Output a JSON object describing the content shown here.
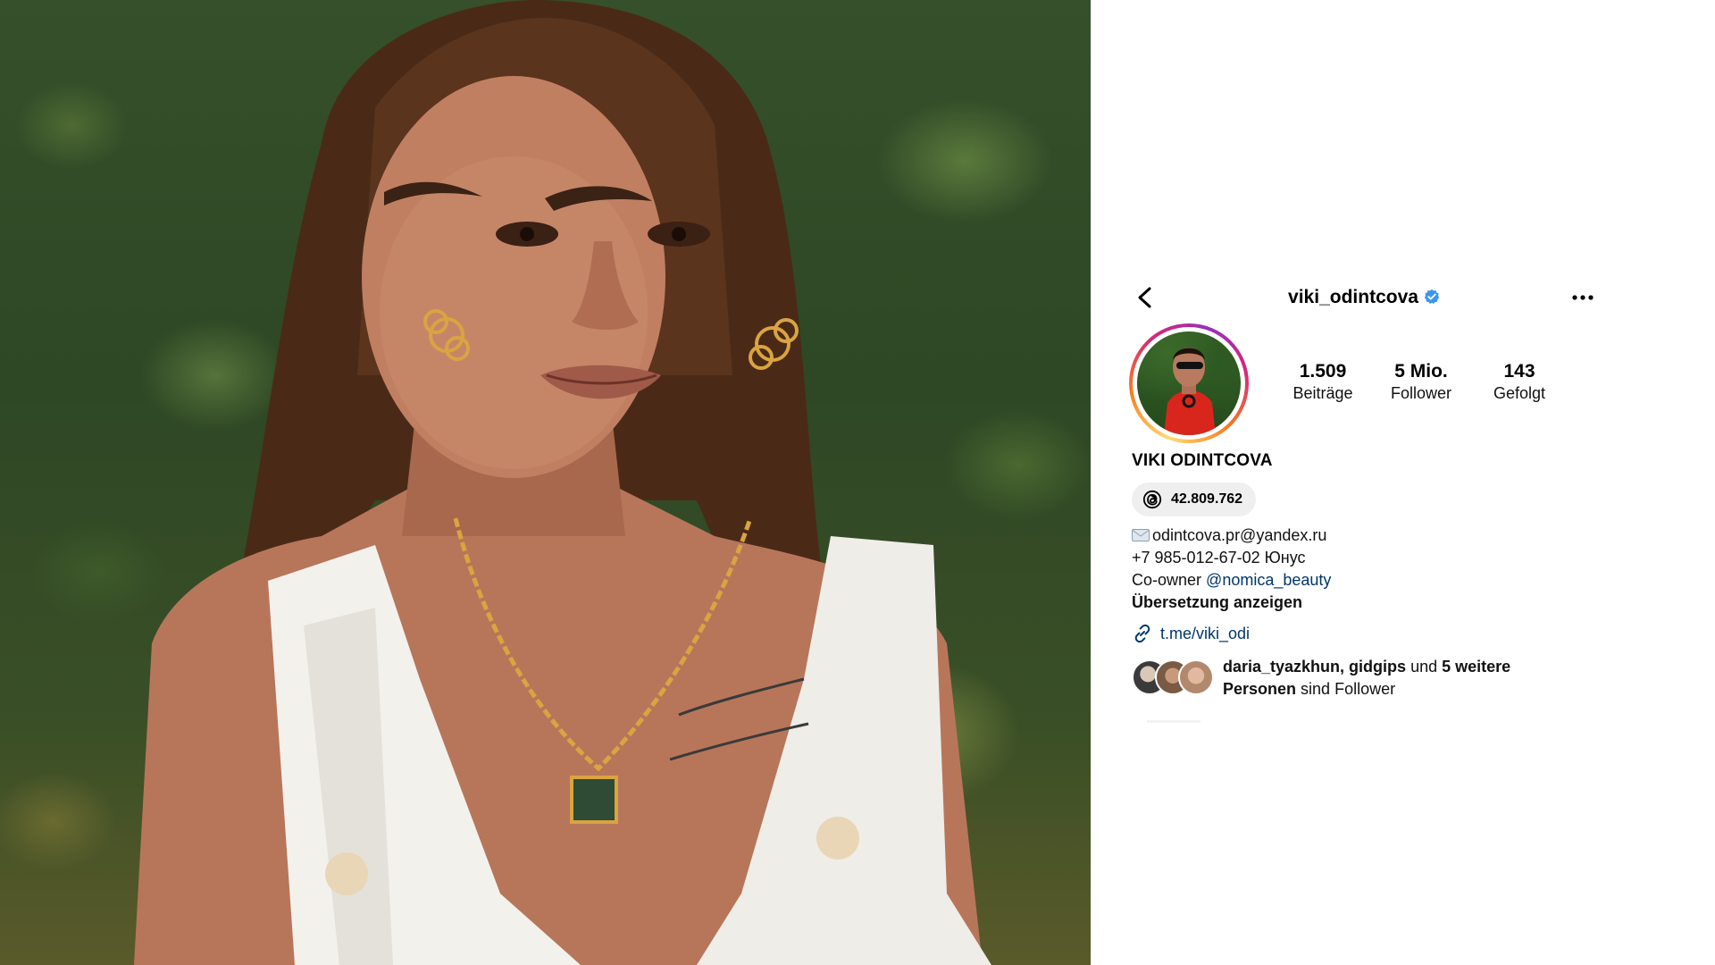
{
  "profile": {
    "username": "viki_odintcova",
    "verified": true,
    "stats": [
      {
        "value": "1.509",
        "label": "Beiträge"
      },
      {
        "value": "5 Mio.",
        "label": "Follower"
      },
      {
        "value": "143",
        "label": "Gefolgt"
      }
    ],
    "full_name": "VIKI ODINTCOVA",
    "threads_count": "42.809.762",
    "bio": {
      "email": "odintcova.pr@yandex.ru",
      "phone": "+7 985-012-67-02 Юнус",
      "coowner_prefix": "Co-owner",
      "coowner_mention": "@nomica_beauty",
      "translate": "Übersetzung anzeigen"
    },
    "link": "t.me/viki_odi",
    "followed_by": {
      "names": "daria_tyazkhun, gidgips",
      "connector": "und",
      "more": "5 weitere",
      "people": "Personen",
      "suffix": "sind Follower"
    }
  },
  "icons": {
    "back": "chevron-left-icon",
    "verified": "verified-badge-icon",
    "more": "more-horizontal-icon",
    "threads": "threads-icon",
    "email": "envelope-icon",
    "link": "link-icon"
  },
  "colors": {
    "link_blue": "#00376b",
    "verified_blue": "#3897f0",
    "pill_bg": "#efefef"
  }
}
